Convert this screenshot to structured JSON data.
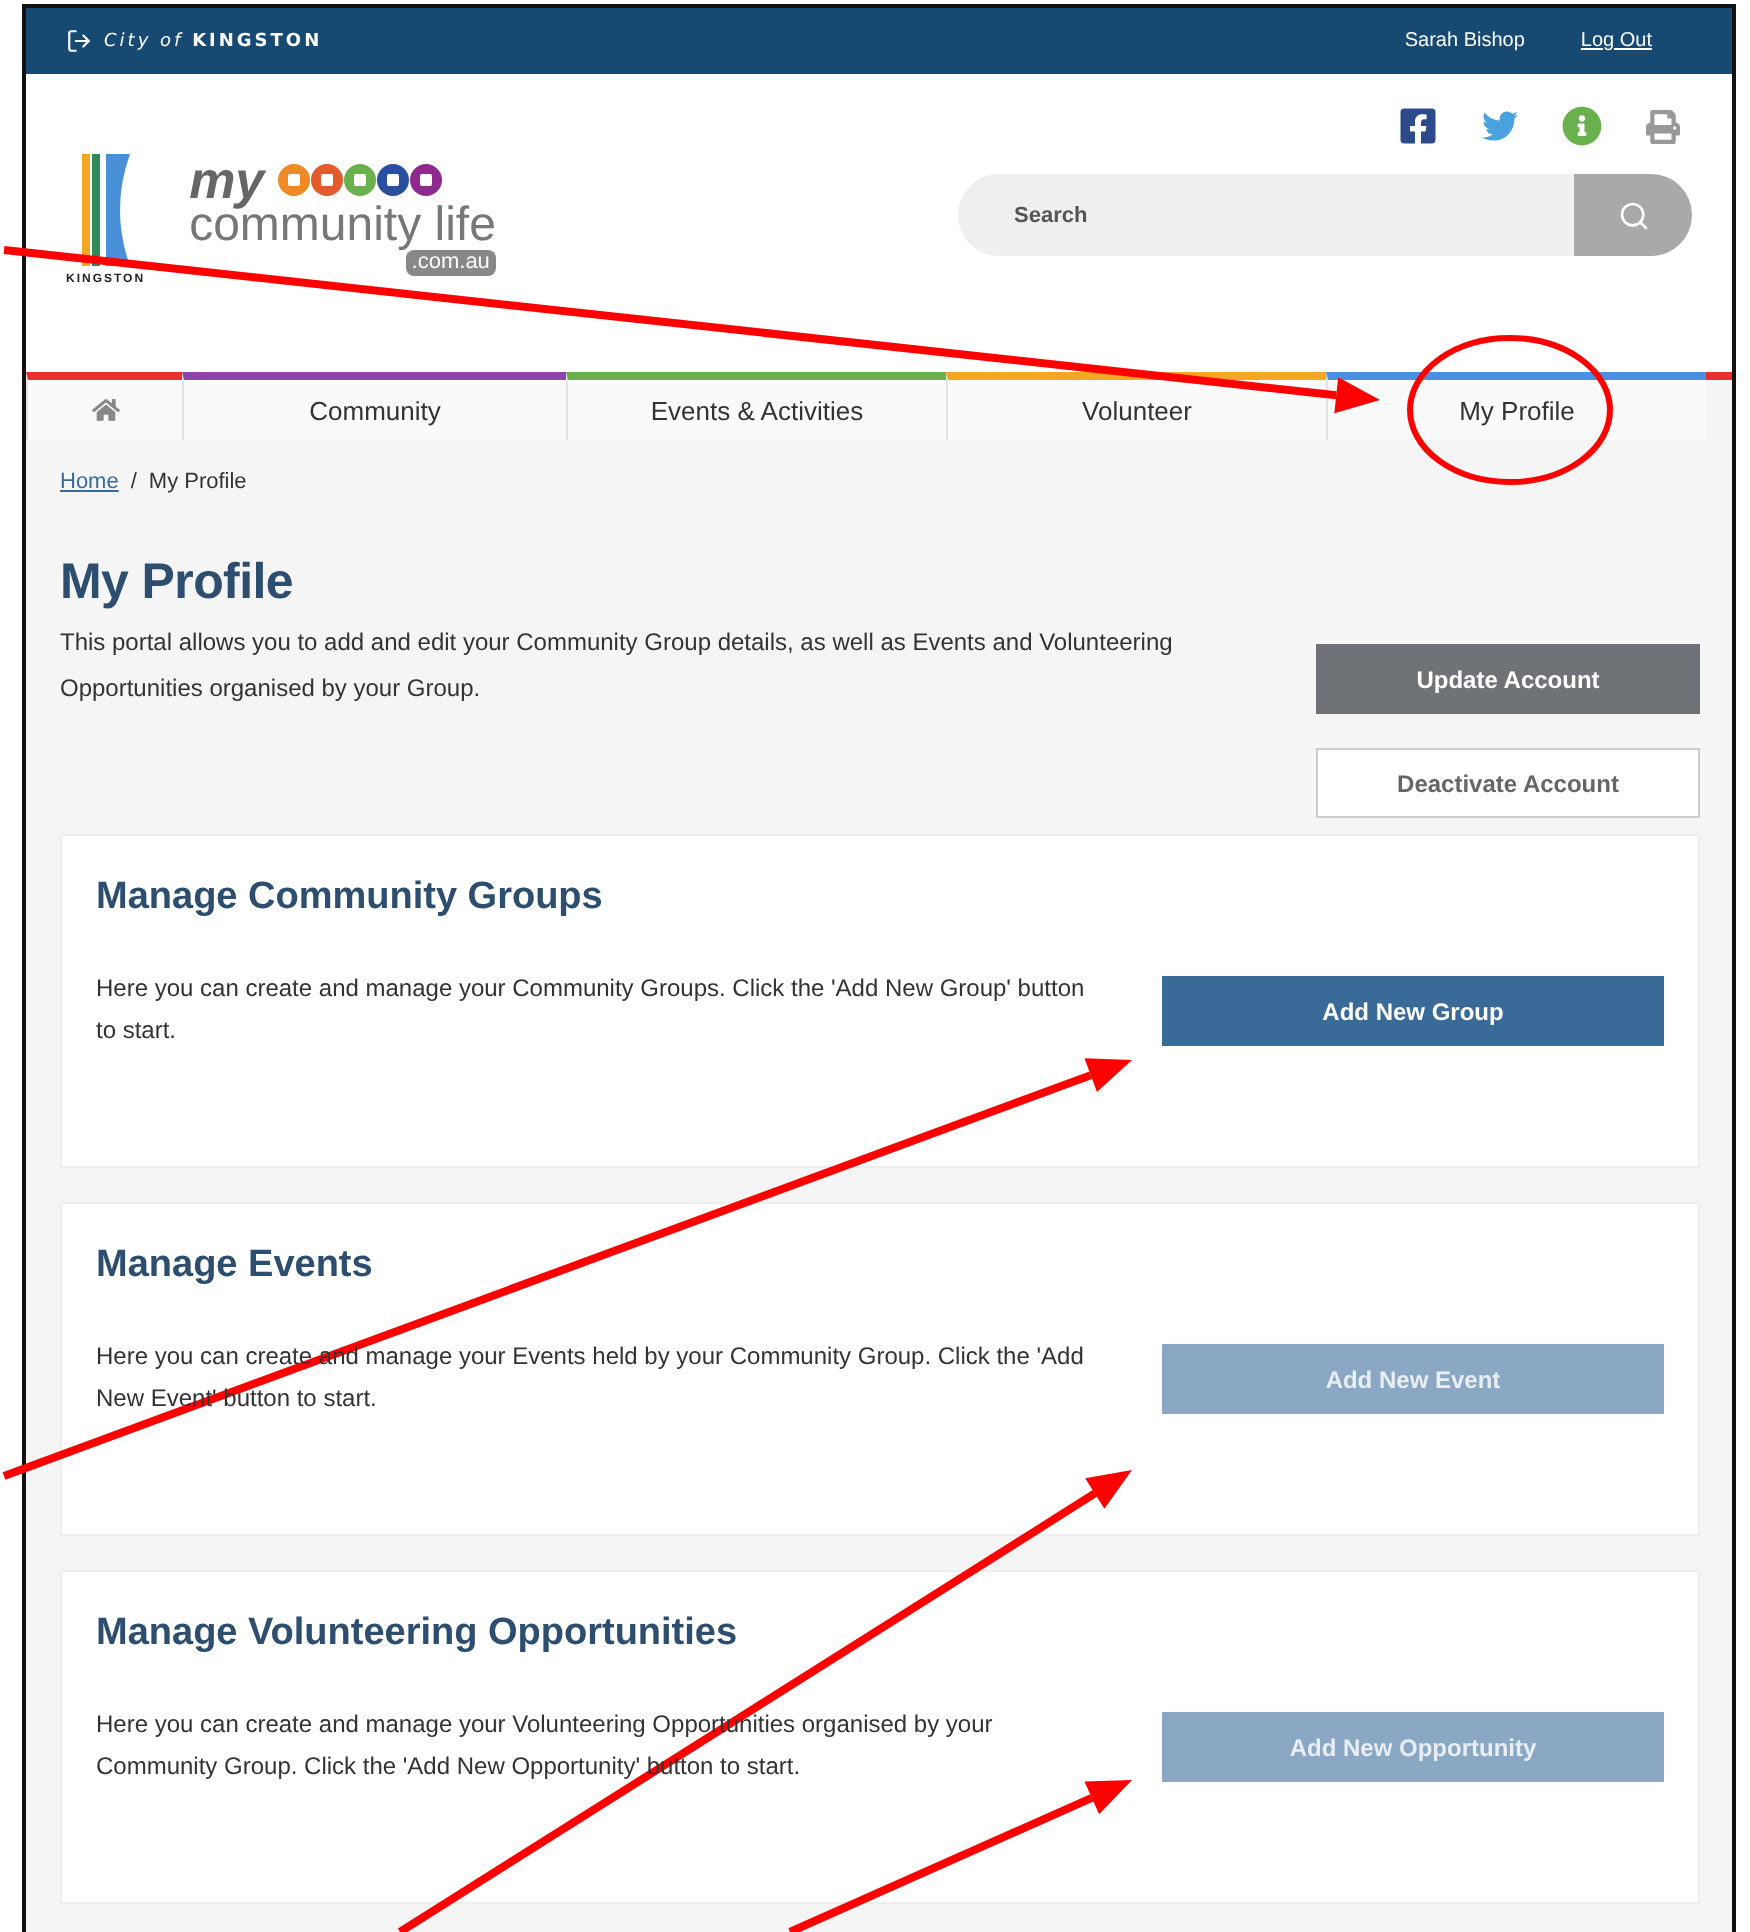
{
  "top_bar": {
    "brand": "*City of* **KINGSTON**",
    "user": "Sarah Bishop",
    "logout": "Log Out"
  },
  "logo": {
    "council": "KINGSTON",
    "my": "my",
    "name": "community life",
    "domain": ".com.au"
  },
  "search": {
    "placeholder": "Search"
  },
  "nav": {
    "items": [
      {
        "label": "Community",
        "color": "#8e44ad"
      },
      {
        "label": "Events & Activities",
        "color": "#6ab04c"
      },
      {
        "label": "Volunteer",
        "color": "#f5a623"
      },
      {
        "label": "My Profile",
        "color": "#4a90e2"
      }
    ]
  },
  "breadcrumb": {
    "separator": "/",
    "items": [
      {
        "label": "Home",
        "link": true
      },
      {
        "label": "My Profile",
        "link": false
      }
    ]
  },
  "page": {
    "title": "My Profile",
    "intro": "This portal allows you to add and edit your Community Group details, as well as Events and Volunteering Opportunities organised by your Group.",
    "buttons": [
      {
        "label": "Update Account",
        "kind": "solid"
      },
      {
        "label": "Deactivate Account",
        "kind": "outline"
      }
    ]
  },
  "sections": [
    {
      "title": "Manage Community Groups",
      "text": "Here you can create and manage your Community Groups. Click the 'Add New Group' button to start.",
      "button": {
        "label": "Add New Group",
        "disabled": false
      }
    },
    {
      "title": "Manage Events",
      "text": "Here you can create and manage your Events held by your Community Group. Click the 'Add New Event' button to start.",
      "button": {
        "label": "Add New Event",
        "disabled": true
      }
    },
    {
      "title": "Manage Volunteering Opportunities",
      "text": "Here you can create and manage your Volunteering Opportunities organised by your Community Group. Click the 'Add New Opportunity' button to start.",
      "button": {
        "label": "Add New Opportunity",
        "disabled": true
      }
    }
  ]
}
